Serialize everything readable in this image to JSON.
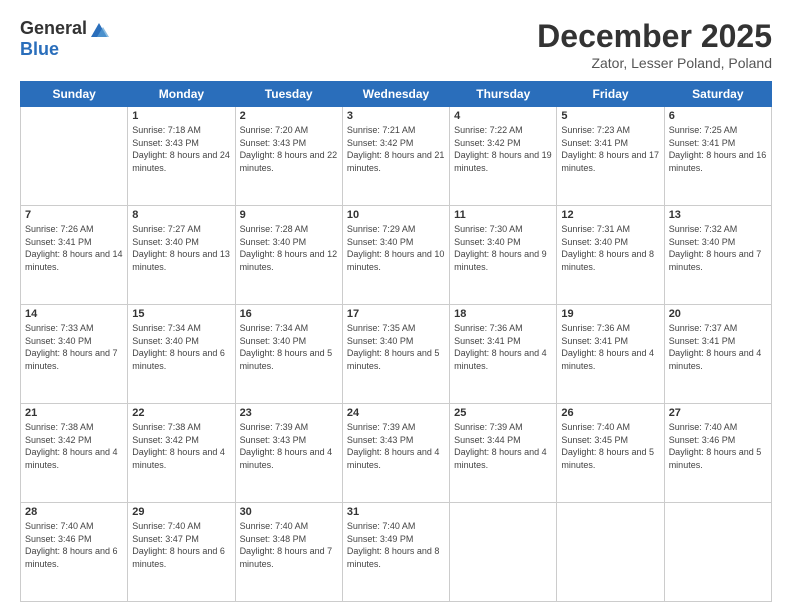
{
  "header": {
    "logo_general": "General",
    "logo_blue": "Blue",
    "month_title": "December 2025",
    "location": "Zator, Lesser Poland, Poland"
  },
  "weekdays": [
    "Sunday",
    "Monday",
    "Tuesday",
    "Wednesday",
    "Thursday",
    "Friday",
    "Saturday"
  ],
  "weeks": [
    [
      {
        "day": "",
        "sunrise": "",
        "sunset": "",
        "daylight": ""
      },
      {
        "day": "1",
        "sunrise": "Sunrise: 7:18 AM",
        "sunset": "Sunset: 3:43 PM",
        "daylight": "Daylight: 8 hours and 24 minutes."
      },
      {
        "day": "2",
        "sunrise": "Sunrise: 7:20 AM",
        "sunset": "Sunset: 3:43 PM",
        "daylight": "Daylight: 8 hours and 22 minutes."
      },
      {
        "day": "3",
        "sunrise": "Sunrise: 7:21 AM",
        "sunset": "Sunset: 3:42 PM",
        "daylight": "Daylight: 8 hours and 21 minutes."
      },
      {
        "day": "4",
        "sunrise": "Sunrise: 7:22 AM",
        "sunset": "Sunset: 3:42 PM",
        "daylight": "Daylight: 8 hours and 19 minutes."
      },
      {
        "day": "5",
        "sunrise": "Sunrise: 7:23 AM",
        "sunset": "Sunset: 3:41 PM",
        "daylight": "Daylight: 8 hours and 17 minutes."
      },
      {
        "day": "6",
        "sunrise": "Sunrise: 7:25 AM",
        "sunset": "Sunset: 3:41 PM",
        "daylight": "Daylight: 8 hours and 16 minutes."
      }
    ],
    [
      {
        "day": "7",
        "sunrise": "Sunrise: 7:26 AM",
        "sunset": "Sunset: 3:41 PM",
        "daylight": "Daylight: 8 hours and 14 minutes."
      },
      {
        "day": "8",
        "sunrise": "Sunrise: 7:27 AM",
        "sunset": "Sunset: 3:40 PM",
        "daylight": "Daylight: 8 hours and 13 minutes."
      },
      {
        "day": "9",
        "sunrise": "Sunrise: 7:28 AM",
        "sunset": "Sunset: 3:40 PM",
        "daylight": "Daylight: 8 hours and 12 minutes."
      },
      {
        "day": "10",
        "sunrise": "Sunrise: 7:29 AM",
        "sunset": "Sunset: 3:40 PM",
        "daylight": "Daylight: 8 hours and 10 minutes."
      },
      {
        "day": "11",
        "sunrise": "Sunrise: 7:30 AM",
        "sunset": "Sunset: 3:40 PM",
        "daylight": "Daylight: 8 hours and 9 minutes."
      },
      {
        "day": "12",
        "sunrise": "Sunrise: 7:31 AM",
        "sunset": "Sunset: 3:40 PM",
        "daylight": "Daylight: 8 hours and 8 minutes."
      },
      {
        "day": "13",
        "sunrise": "Sunrise: 7:32 AM",
        "sunset": "Sunset: 3:40 PM",
        "daylight": "Daylight: 8 hours and 7 minutes."
      }
    ],
    [
      {
        "day": "14",
        "sunrise": "Sunrise: 7:33 AM",
        "sunset": "Sunset: 3:40 PM",
        "daylight": "Daylight: 8 hours and 7 minutes."
      },
      {
        "day": "15",
        "sunrise": "Sunrise: 7:34 AM",
        "sunset": "Sunset: 3:40 PM",
        "daylight": "Daylight: 8 hours and 6 minutes."
      },
      {
        "day": "16",
        "sunrise": "Sunrise: 7:34 AM",
        "sunset": "Sunset: 3:40 PM",
        "daylight": "Daylight: 8 hours and 5 minutes."
      },
      {
        "day": "17",
        "sunrise": "Sunrise: 7:35 AM",
        "sunset": "Sunset: 3:40 PM",
        "daylight": "Daylight: 8 hours and 5 minutes."
      },
      {
        "day": "18",
        "sunrise": "Sunrise: 7:36 AM",
        "sunset": "Sunset: 3:41 PM",
        "daylight": "Daylight: 8 hours and 4 minutes."
      },
      {
        "day": "19",
        "sunrise": "Sunrise: 7:36 AM",
        "sunset": "Sunset: 3:41 PM",
        "daylight": "Daylight: 8 hours and 4 minutes."
      },
      {
        "day": "20",
        "sunrise": "Sunrise: 7:37 AM",
        "sunset": "Sunset: 3:41 PM",
        "daylight": "Daylight: 8 hours and 4 minutes."
      }
    ],
    [
      {
        "day": "21",
        "sunrise": "Sunrise: 7:38 AM",
        "sunset": "Sunset: 3:42 PM",
        "daylight": "Daylight: 8 hours and 4 minutes."
      },
      {
        "day": "22",
        "sunrise": "Sunrise: 7:38 AM",
        "sunset": "Sunset: 3:42 PM",
        "daylight": "Daylight: 8 hours and 4 minutes."
      },
      {
        "day": "23",
        "sunrise": "Sunrise: 7:39 AM",
        "sunset": "Sunset: 3:43 PM",
        "daylight": "Daylight: 8 hours and 4 minutes."
      },
      {
        "day": "24",
        "sunrise": "Sunrise: 7:39 AM",
        "sunset": "Sunset: 3:43 PM",
        "daylight": "Daylight: 8 hours and 4 minutes."
      },
      {
        "day": "25",
        "sunrise": "Sunrise: 7:39 AM",
        "sunset": "Sunset: 3:44 PM",
        "daylight": "Daylight: 8 hours and 4 minutes."
      },
      {
        "day": "26",
        "sunrise": "Sunrise: 7:40 AM",
        "sunset": "Sunset: 3:45 PM",
        "daylight": "Daylight: 8 hours and 5 minutes."
      },
      {
        "day": "27",
        "sunrise": "Sunrise: 7:40 AM",
        "sunset": "Sunset: 3:46 PM",
        "daylight": "Daylight: 8 hours and 5 minutes."
      }
    ],
    [
      {
        "day": "28",
        "sunrise": "Sunrise: 7:40 AM",
        "sunset": "Sunset: 3:46 PM",
        "daylight": "Daylight: 8 hours and 6 minutes."
      },
      {
        "day": "29",
        "sunrise": "Sunrise: 7:40 AM",
        "sunset": "Sunset: 3:47 PM",
        "daylight": "Daylight: 8 hours and 6 minutes."
      },
      {
        "day": "30",
        "sunrise": "Sunrise: 7:40 AM",
        "sunset": "Sunset: 3:48 PM",
        "daylight": "Daylight: 8 hours and 7 minutes."
      },
      {
        "day": "31",
        "sunrise": "Sunrise: 7:40 AM",
        "sunset": "Sunset: 3:49 PM",
        "daylight": "Daylight: 8 hours and 8 minutes."
      },
      {
        "day": "",
        "sunrise": "",
        "sunset": "",
        "daylight": ""
      },
      {
        "day": "",
        "sunrise": "",
        "sunset": "",
        "daylight": ""
      },
      {
        "day": "",
        "sunrise": "",
        "sunset": "",
        "daylight": ""
      }
    ]
  ]
}
